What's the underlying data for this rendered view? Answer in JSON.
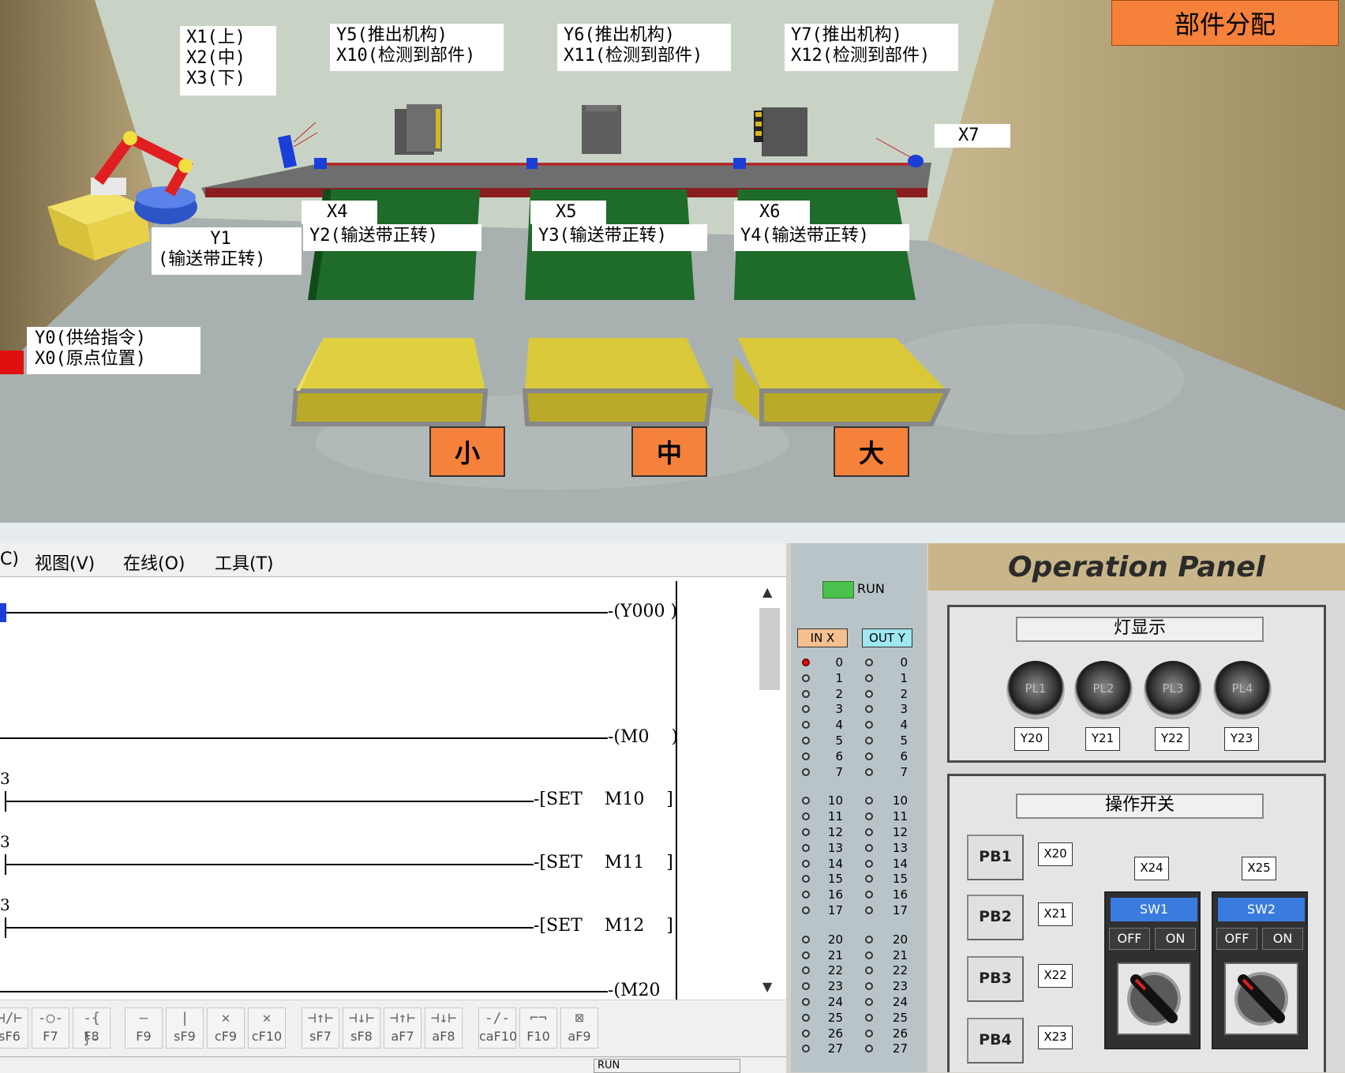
{
  "scene": {
    "assign_title": "部件分配",
    "labels": {
      "x123": "X1(上)\nX2(中)\nX3(下)",
      "y5": "Y5(推出机构)\nX10(检测到部件)",
      "y6": "Y6(推出机构)\nX11(检测到部件)",
      "y7": "Y7(推出机构)\nX12(检测到部件)",
      "x7": "X7",
      "x4": "X4",
      "x5": "X5",
      "x6": "X6",
      "y1": "     Y1\n(输送带正转)",
      "y2": "Y2(输送带正转)",
      "y3": "Y3(输送带正转)",
      "y4": "Y4(输送带正转)",
      "y0": "Y0(供给指令)\nX0(原点位置)"
    },
    "bins": {
      "small": "小",
      "medium": "中",
      "large": "大"
    }
  },
  "menu": {
    "edge": "C)",
    "view": "视图(V)",
    "online": "在线(O)",
    "tools": "工具(T)"
  },
  "ladder": {
    "rungs": [
      {
        "num": "",
        "coil": "-(Y000 )"
      },
      {
        "num": "",
        "coil": "-(M0    )"
      },
      {
        "num": "3",
        "coil": "-[SET    M10    ]"
      },
      {
        "num": "3",
        "coil": "-[SET    M11    ]"
      },
      {
        "num": "3",
        "coil": "-[SET    M12    ]"
      },
      {
        "num": "",
        "coil": "-(M20   )"
      }
    ]
  },
  "toolbar": [
    {
      "glyph": "⊣/⊢",
      "key": "sF6"
    },
    {
      "glyph": "-○-",
      "key": "F7"
    },
    {
      "glyph": "-{ }-",
      "key": "F8"
    },
    {
      "glyph": "—",
      "key": "F9"
    },
    {
      "glyph": "|",
      "key": "sF9"
    },
    {
      "glyph": "✕",
      "key": "cF9"
    },
    {
      "glyph": "✕",
      "key": "cF10"
    },
    {
      "glyph": "⊣↑⊢",
      "key": "sF7"
    },
    {
      "glyph": "⊣↓⊢",
      "key": "sF8"
    },
    {
      "glyph": "⊣↑⊢",
      "key": "aF7"
    },
    {
      "glyph": "⊣↓⊢",
      "key": "aF8"
    },
    {
      "glyph": "-/-",
      "key": "caF10"
    },
    {
      "glyph": "⌐¬",
      "key": "F10"
    },
    {
      "glyph": "⊠",
      "key": "aF9"
    }
  ],
  "status": {
    "mode": "RUN"
  },
  "io": {
    "run_label": "RUN",
    "in_header": "IN X",
    "out_header": "OUT Y",
    "numbers": [
      "0",
      "1",
      "2",
      "3",
      "4",
      "5",
      "6",
      "7",
      "10",
      "11",
      "12",
      "13",
      "14",
      "15",
      "16",
      "17",
      "20",
      "21",
      "22",
      "23",
      "24",
      "25",
      "26",
      "27"
    ],
    "in_active_color": "#e01010",
    "run_color": "#4cc04c"
  },
  "panel": {
    "title": "Operation Panel",
    "lamp_section": "灯显示",
    "switch_section": "操作开关",
    "lamps": [
      {
        "name": "PL1",
        "out": "Y20"
      },
      {
        "name": "PL2",
        "out": "Y21"
      },
      {
        "name": "PL3",
        "out": "Y22"
      },
      {
        "name": "PL4",
        "out": "Y23"
      }
    ],
    "buttons": [
      {
        "name": "PB1",
        "in": "X20"
      },
      {
        "name": "PB2",
        "in": "X21"
      },
      {
        "name": "PB3",
        "in": "X22"
      },
      {
        "name": "PB4",
        "in": "X23"
      }
    ],
    "switches": [
      {
        "name": "SW1",
        "in": "X24",
        "off": "OFF",
        "on": "ON"
      },
      {
        "name": "SW2",
        "in": "X25",
        "off": "OFF",
        "on": "ON"
      }
    ]
  }
}
